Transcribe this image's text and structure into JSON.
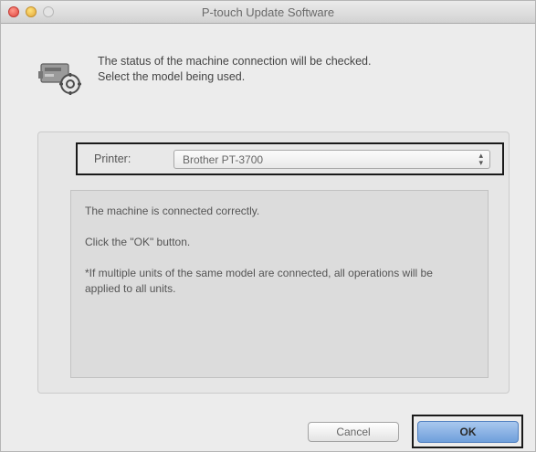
{
  "window": {
    "title": "P-touch Update Software"
  },
  "intro": {
    "line1": "The status of the machine connection will be checked.",
    "line2": "Select the model being used."
  },
  "printer": {
    "label": "Printer:",
    "selected": "Brother PT-3700"
  },
  "message": {
    "line1": "The machine is connected correctly.",
    "line2": "Click the \"OK\" button.",
    "line3": "*If multiple units of the same model are connected, all operations will be applied to all units."
  },
  "buttons": {
    "cancel": "Cancel",
    "ok": "OK"
  },
  "icons": {
    "app": "machine-connection-icon",
    "select": "updown-arrows-icon"
  }
}
